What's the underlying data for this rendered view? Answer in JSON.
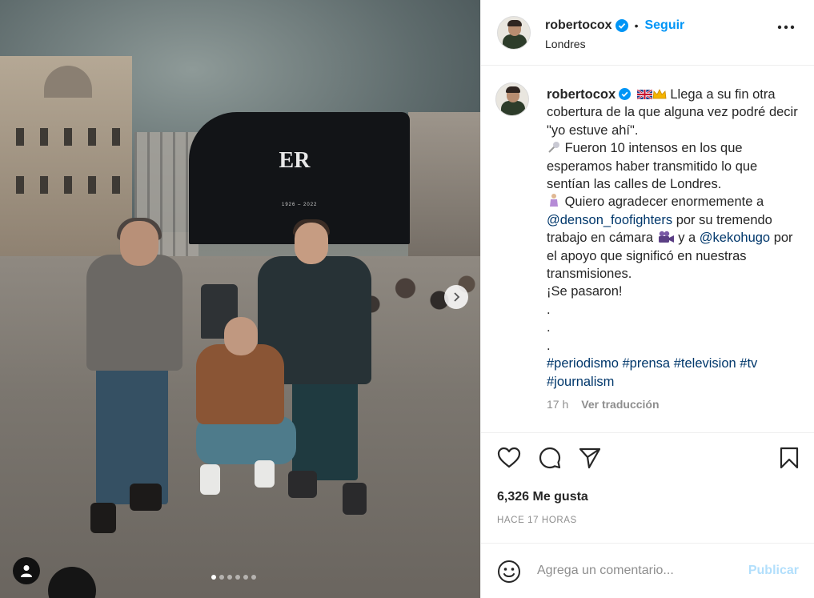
{
  "post": {
    "username": "robertocox",
    "separator": "•",
    "follow_label": "Seguir",
    "location": "Londres"
  },
  "photo": {
    "screen_crest": "ER",
    "screen_years": "1926 – 2022",
    "carousel_count": 6,
    "carousel_active": 0
  },
  "caption": {
    "username": "robertocox",
    "line1": "Llega a su fin otra cobertura de la que alguna vez podré decir \"yo estuve ahí\".",
    "line2": "Fueron 10 intensos en los que esperamos haber transmitido lo que sentían las calles de Londres.",
    "line3_a": "Quiero agradecer enormemente a",
    "mention1": "@denson_foofighters",
    "line3_b": "por su tremendo trabajo en cámara",
    "line3_c": "y a",
    "mention2": "@kekohugo",
    "line3_d": "por el apoyo que significó en nuestras transmisiones.",
    "line4": "¡Se pasaron!",
    "dot": ".",
    "hashtags": [
      "#periodismo",
      "#prensa",
      "#television",
      "#tv",
      "#journalism"
    ],
    "time": "17 h",
    "translate_label": "Ver traducción"
  },
  "actions": {
    "likes": "6,326 Me gusta",
    "posted_ago": "HACE 17 HORAS"
  },
  "comment": {
    "placeholder": "Agrega un comentario...",
    "publish_label": "Publicar"
  },
  "icons": {
    "verified": "verified-badge-icon",
    "more": "more-options-icon",
    "like": "heart-icon",
    "comment": "comment-bubble-icon",
    "share": "paper-plane-icon",
    "save": "bookmark-icon",
    "emoji": "smiley-icon",
    "tag": "user-tag-icon",
    "next": "chevron-right-icon"
  },
  "colors": {
    "accent": "#0095f6",
    "link": "#00376b",
    "muted": "#8e8e8e",
    "publish_disabled": "#b2dffc"
  }
}
